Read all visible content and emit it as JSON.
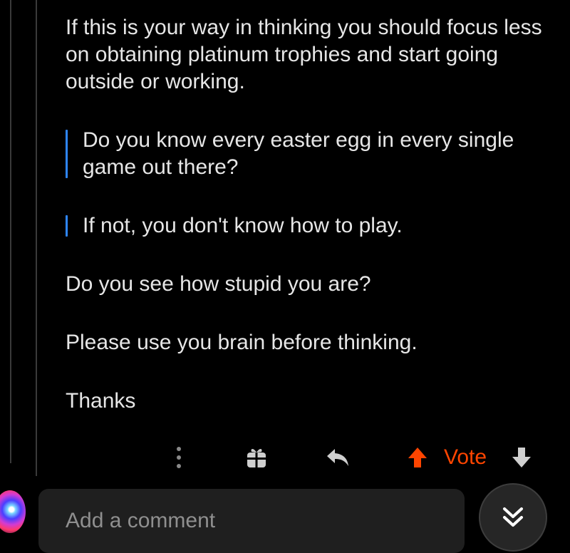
{
  "comment": {
    "paragraphs": [
      "If this is your way in thinking you should focus less on obtaining platinum trophies and start going outside or working."
    ],
    "quotes": [
      "Do you know every easter egg in every single game out there?",
      "If not, you don't know how to play."
    ],
    "closing": [
      "Do you see how stupid you are?",
      "Please use you brain before thinking.",
      "Thanks"
    ]
  },
  "actions": {
    "more_icon": "vertical-dots-icon",
    "award_icon": "gift-icon",
    "reply_icon": "reply-arrow-icon",
    "upvote_icon": "arrow-up-icon",
    "vote_label": "Vote",
    "downvote_icon": "arrow-down-icon"
  },
  "composer": {
    "placeholder": "Add a comment",
    "jump_icon": "double-chevron-down-icon"
  },
  "colors": {
    "background": "#000000",
    "text": "#e6e6e6",
    "quote_bar": "#2e86ff",
    "vote_accent": "#ff4500",
    "input_bg": "#1f1f1f"
  }
}
